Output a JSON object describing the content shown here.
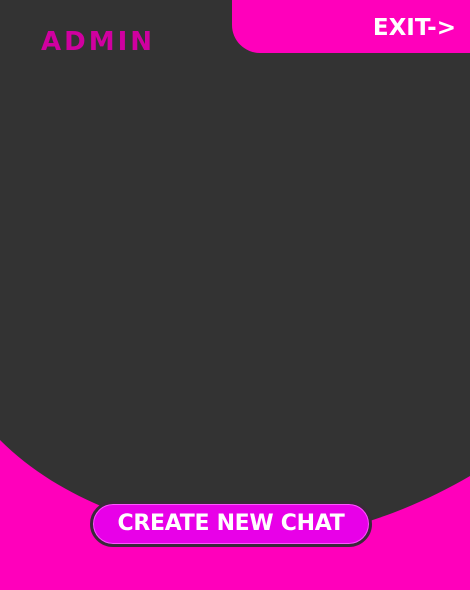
{
  "header": {
    "title": "ADMIN",
    "exit_label": "EXIT->"
  },
  "actions": {
    "create_chat_label": "CREATE NEW CHAT"
  },
  "colors": {
    "background": "#333333",
    "accent": "#FF00BB",
    "title": "#D000A0",
    "button": "#E800E8",
    "text_on_accent": "#FFFFFF"
  }
}
